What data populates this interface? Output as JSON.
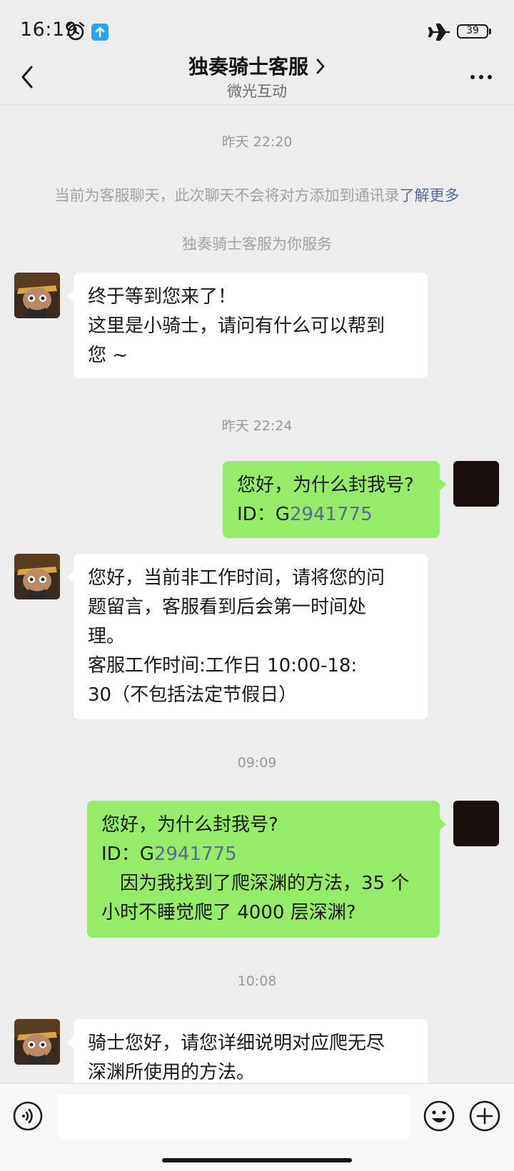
{
  "status_bar": {
    "time": "16:19",
    "battery": "39"
  },
  "header": {
    "title": "独奏骑士客服",
    "subtitle": "微光互动"
  },
  "chat": {
    "timestamps": [
      "昨天 22:20",
      "昨天 22:24",
      "09:09",
      "10:08"
    ],
    "notice": {
      "text": "当前为客服聊天，此次聊天不会将对方添加到通讯录",
      "link": "了解更多"
    },
    "service_notice": "独奏骑士客服为你服务",
    "msg1": {
      "lines": [
        "终于等到您来了！",
        "这里是小骑士，请问有什么可以帮到",
        "您 ~"
      ]
    },
    "msg2": {
      "line1": "您好，为什么封我号?",
      "id_prefix": "ID：G",
      "id_number": "2941775"
    },
    "msg3": {
      "lines": [
        "您好，当前非工作时间，请将您的问",
        "题留言，客服看到后会第一时间处",
        "理。",
        "客服工作时间:工作日 10:00-18:",
        "30（不包括法定节假日）"
      ]
    },
    "msg4": {
      "line1": "您好，为什么封我号?",
      "id_prefix": "ID：G",
      "id_number": "2941775",
      "line3": "　因为我找到了爬深渊的方法，35 个",
      "line4": "小时不睡觉爬了 4000 层深渊?"
    },
    "msg5": {
      "lines": [
        "骑士您好，请您详细说明对应爬无尽",
        "深渊所使用的方法。"
      ]
    }
  },
  "input": {
    "placeholder": ""
  }
}
